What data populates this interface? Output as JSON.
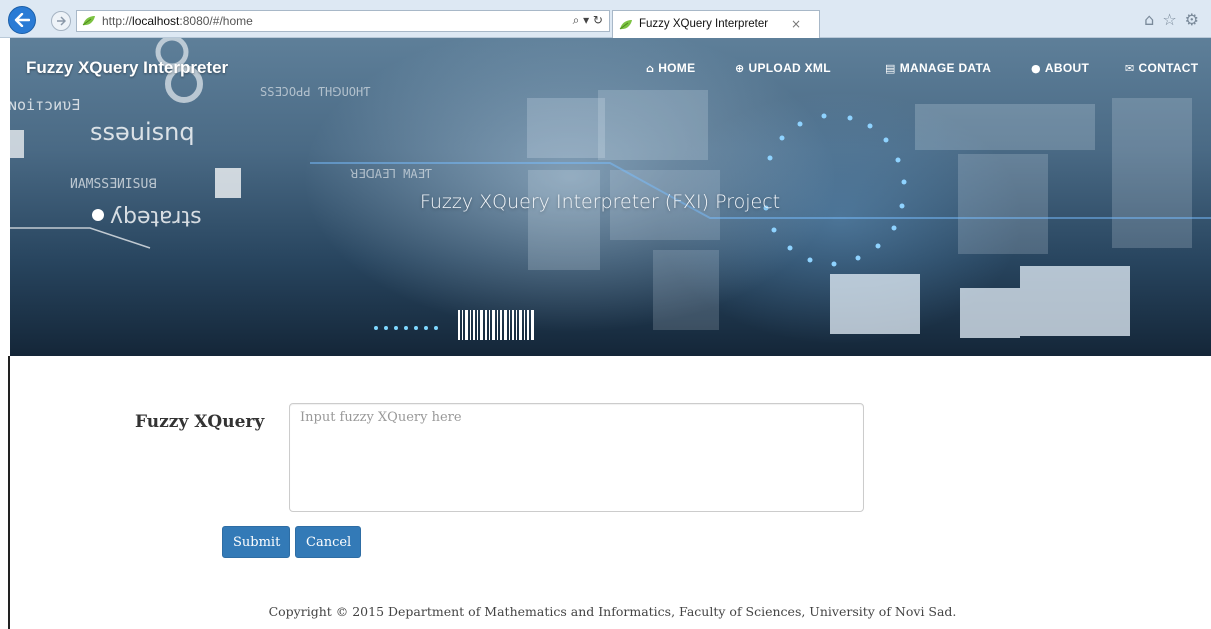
{
  "browser": {
    "url_prefix": "http://",
    "url_host": "localhost",
    "url_rest": ":8080/#/home",
    "address_icons": "⌕ ▾ ↻",
    "tab_title": "Fuzzy XQuery Interpreter",
    "tab_close": "×",
    "toolbar_icons": [
      "⌂",
      "☆",
      "⚙"
    ],
    "accent_color": "#2a7bd5"
  },
  "header": {
    "brand": "Fuzzy XQuery Interpreter",
    "nav": [
      {
        "icon": "home-icon",
        "glyph": "⌂",
        "label": "HOME"
      },
      {
        "icon": "upload-icon",
        "glyph": "⊕",
        "label": "UPLOAD XML"
      },
      {
        "icon": "list-icon",
        "glyph": "▤",
        "label": "MANAGE DATA"
      },
      {
        "icon": "info-icon",
        "glyph": "●",
        "label": "ABOUT"
      },
      {
        "icon": "envelope-icon",
        "glyph": "✉",
        "label": "CONTACT"
      }
    ],
    "hero_title": "Fuzzy XQuery Interpreter (FXI) Project"
  },
  "form": {
    "label": "Fuzzy XQuery",
    "input_value": "",
    "input_placeholder": "Input fuzzy XQuery here",
    "submit_label": "Submit",
    "cancel_label": "Cancel",
    "button_color": "#337ab7"
  },
  "footer": {
    "copyright": "Copyright © 2015 Department of Mathematics and Informatics, Faculty of Sciences, University of Novi Sad."
  }
}
